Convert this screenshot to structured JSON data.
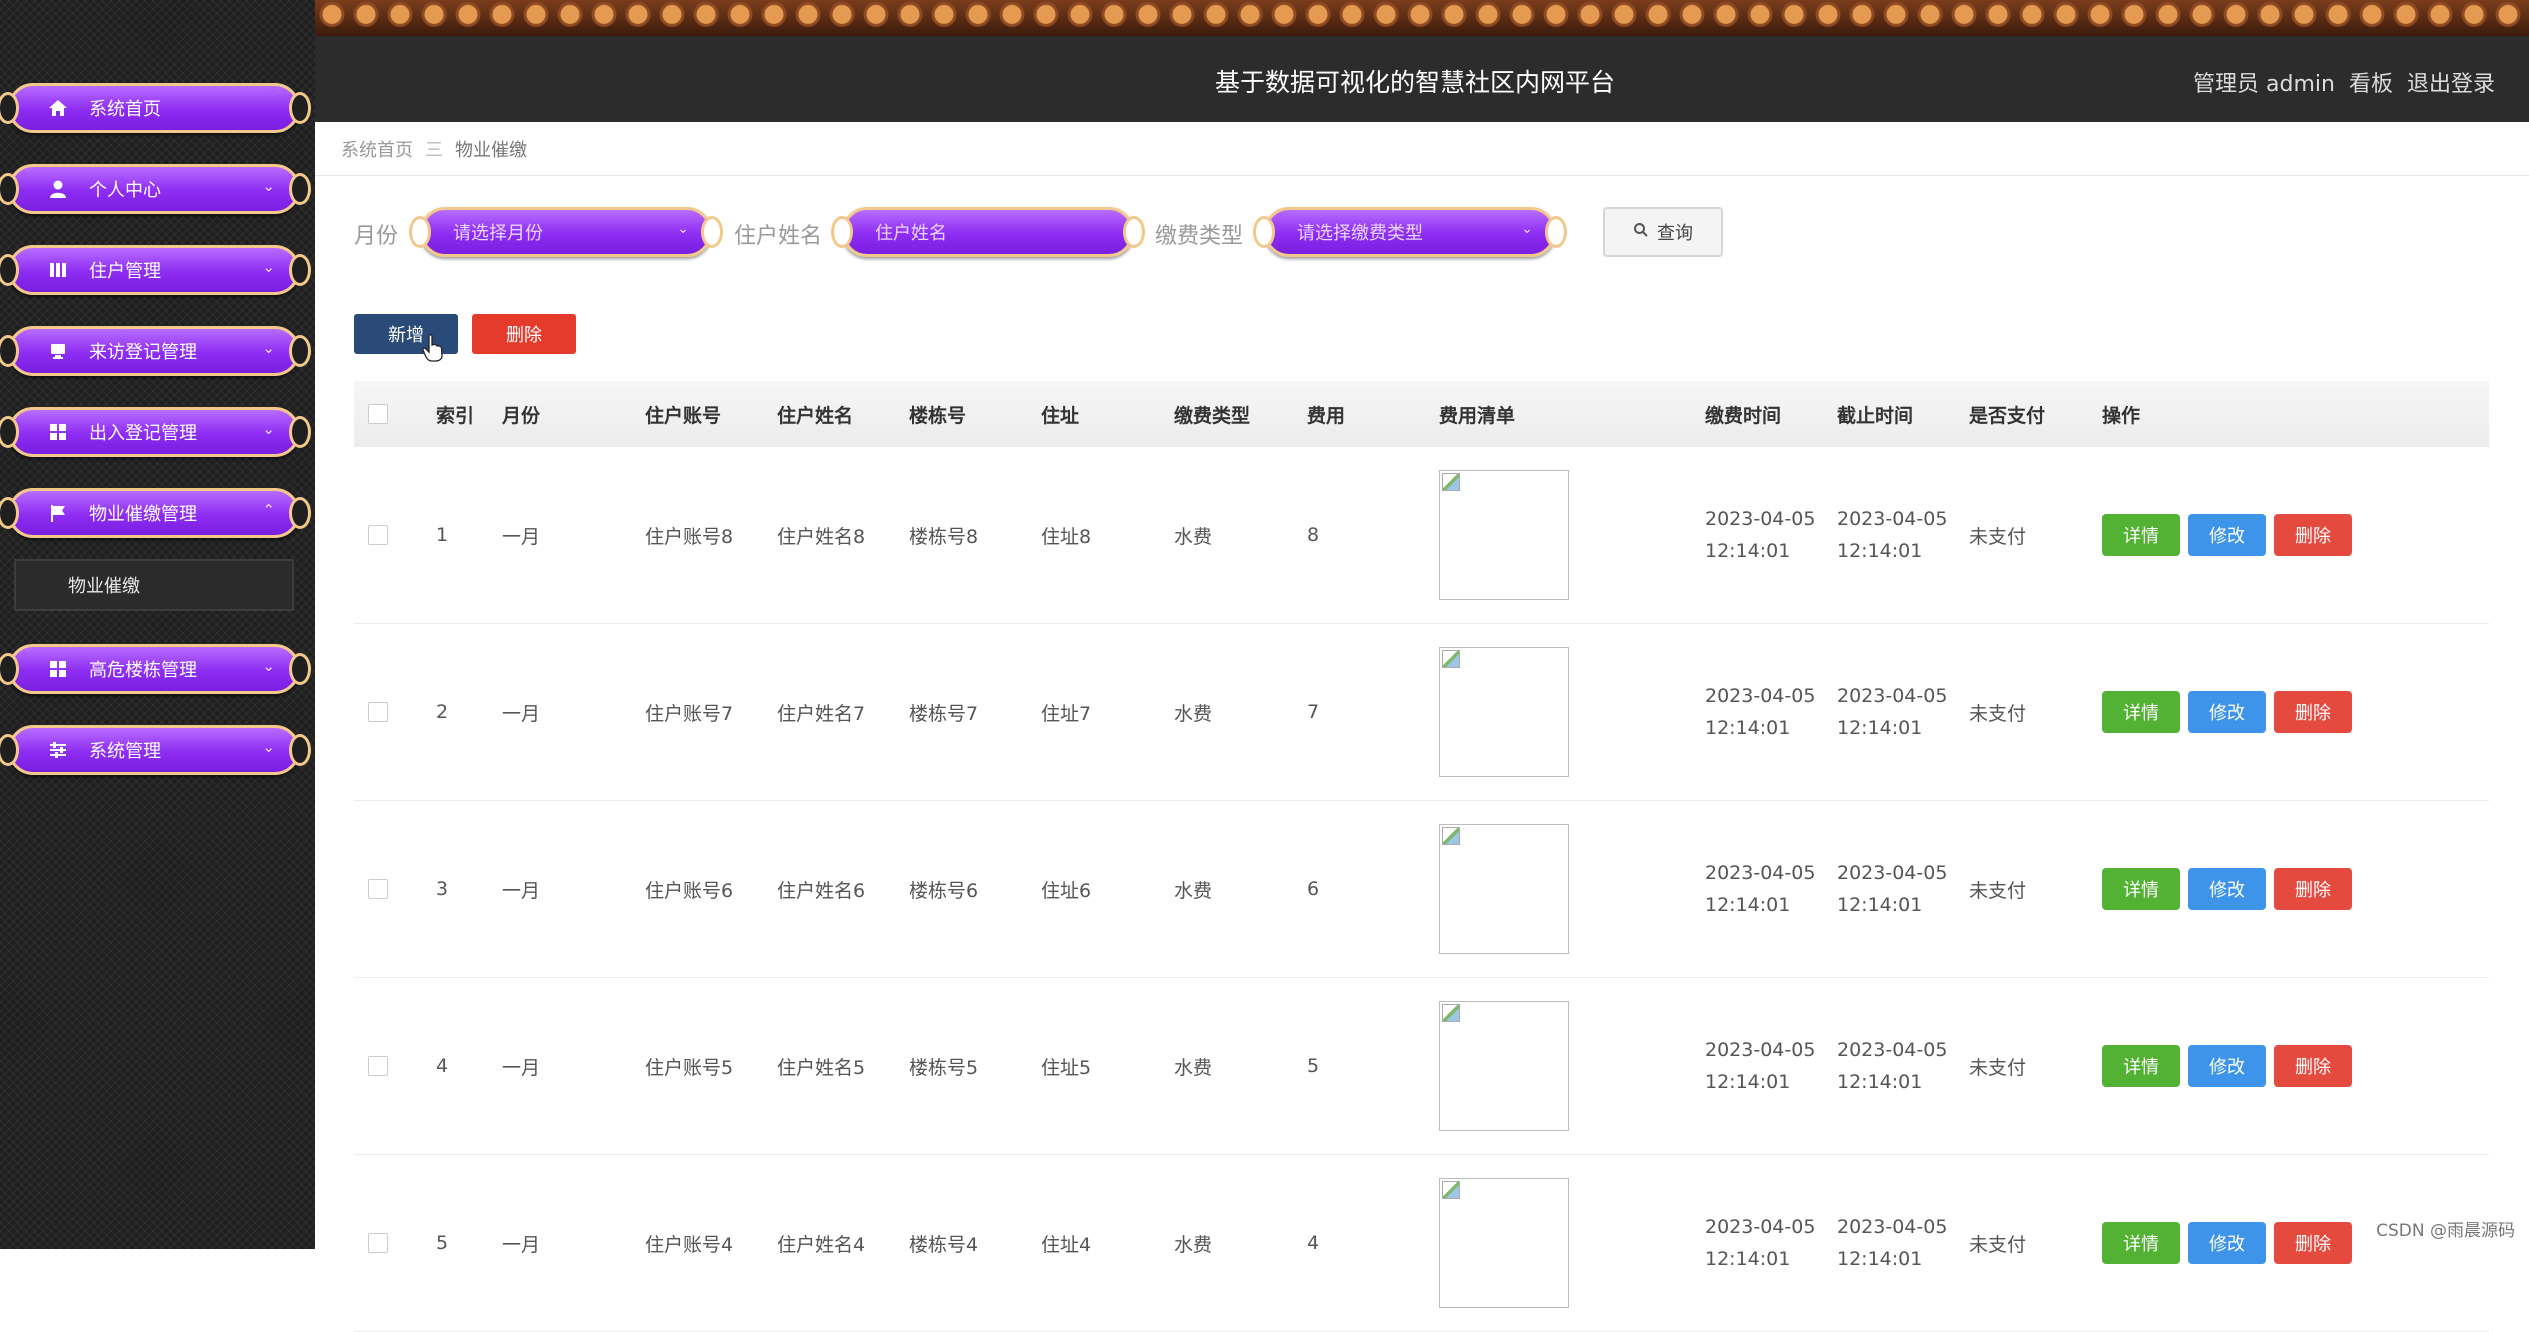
{
  "header": {
    "title": "基于数据可视化的智慧社区内网平台",
    "user_label": "管理员 admin",
    "board_label": "看板",
    "logout_label": "退出登录"
  },
  "sidebar": {
    "items": [
      {
        "label": "系统首页",
        "icon": "home-icon",
        "chevron": ""
      },
      {
        "label": "个人中心",
        "icon": "user-icon",
        "chevron": "⌄"
      },
      {
        "label": "住户管理",
        "icon": "book-icon",
        "chevron": "⌄"
      },
      {
        "label": "来访登记管理",
        "icon": "monitor-icon",
        "chevron": "⌄"
      },
      {
        "label": "出入登记管理",
        "icon": "grid-icon",
        "chevron": "⌄"
      },
      {
        "label": "物业催缴管理",
        "icon": "flag-icon",
        "chevron": "⌃"
      },
      {
        "label": "高危楼栋管理",
        "icon": "grid-icon",
        "chevron": "⌄"
      },
      {
        "label": "系统管理",
        "icon": "sliders-icon",
        "chevron": "⌄"
      }
    ],
    "submenu_label": "物业催缴"
  },
  "breadcrumb": {
    "home": "系统首页",
    "separator": "三",
    "current": "物业催缴"
  },
  "search": {
    "month_label": "月份",
    "month_placeholder": "请选择月份",
    "name_label": "住户姓名",
    "name_placeholder": "住户姓名",
    "type_label": "缴费类型",
    "type_placeholder": "请选择缴费类型",
    "query_label": "查询"
  },
  "actions": {
    "add_label": "新增",
    "delete_label": "删除"
  },
  "table": {
    "headers": [
      "索引",
      "月份",
      "住户账号",
      "住户姓名",
      "楼栋号",
      "住址",
      "缴费类型",
      "费用",
      "费用清单",
      "缴费时间",
      "截止时间",
      "是否支付",
      "操作"
    ],
    "rows": [
      {
        "index": "1",
        "month": "一月",
        "account": "住户账号8",
        "name": "住户姓名8",
        "building": "楼栋号8",
        "address": "住址8",
        "fee_type": "水费",
        "fee": "8",
        "pay_date": "2023-04-05",
        "pay_time": "12:14:01",
        "due_date": "2023-04-05",
        "due_time": "12:14:01",
        "paid": "未支付"
      },
      {
        "index": "2",
        "month": "一月",
        "account": "住户账号7",
        "name": "住户姓名7",
        "building": "楼栋号7",
        "address": "住址7",
        "fee_type": "水费",
        "fee": "7",
        "pay_date": "2023-04-05",
        "pay_time": "12:14:01",
        "due_date": "2023-04-05",
        "due_time": "12:14:01",
        "paid": "未支付"
      },
      {
        "index": "3",
        "month": "一月",
        "account": "住户账号6",
        "name": "住户姓名6",
        "building": "楼栋号6",
        "address": "住址6",
        "fee_type": "水费",
        "fee": "6",
        "pay_date": "2023-04-05",
        "pay_time": "12:14:01",
        "due_date": "2023-04-05",
        "due_time": "12:14:01",
        "paid": "未支付"
      },
      {
        "index": "4",
        "month": "一月",
        "account": "住户账号5",
        "name": "住户姓名5",
        "building": "楼栋号5",
        "address": "住址5",
        "fee_type": "水费",
        "fee": "5",
        "pay_date": "2023-04-05",
        "pay_time": "12:14:01",
        "due_date": "2023-04-05",
        "due_time": "12:14:01",
        "paid": "未支付"
      },
      {
        "index": "5",
        "month": "一月",
        "account": "住户账号4",
        "name": "住户姓名4",
        "building": "楼栋号4",
        "address": "住址4",
        "fee_type": "水费",
        "fee": "4",
        "pay_date": "2023-04-05",
        "pay_time": "12:14:01",
        "due_date": "2023-04-05",
        "due_time": "12:14:01",
        "paid": "未支付"
      }
    ],
    "op_detail": "详情",
    "op_edit": "修改",
    "op_delete": "删除"
  },
  "watermark": "CSDN @雨晨源码",
  "colors": {
    "menu_purple": "#8d2cf2",
    "menu_border": "#f3c98b",
    "sidebar_bg": "#1f1f1f",
    "header_bg": "#2c2c2c",
    "add_button": "#2a4a78",
    "danger": "#e53b2c",
    "detail_green": "#53b234",
    "edit_blue": "#3e94e8"
  }
}
